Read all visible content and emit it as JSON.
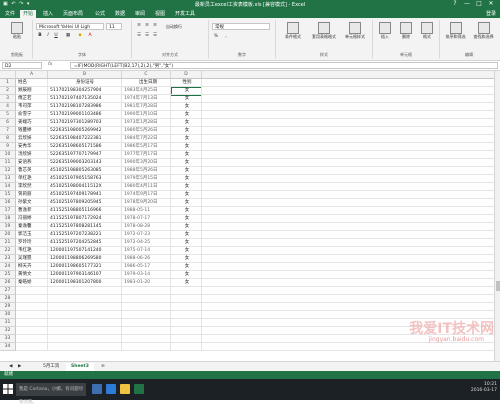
{
  "window": {
    "title": "最新员工excel工资表模板.xls [兼容模式] - Excel",
    "quick_access": "▣ ↶ ↷ ▾",
    "controls": [
      "?",
      "—",
      "□",
      "✕"
    ]
  },
  "ribbon_tabs": [
    "文件",
    "开始",
    "插入",
    "页面布局",
    "公式",
    "数据",
    "审阅",
    "视图",
    "开发工具"
  ],
  "ribbon_active_index": 1,
  "user_label": "登录",
  "ribbon": {
    "clipboard": {
      "paste": "粘贴",
      "caption": "剪贴板"
    },
    "font": {
      "family": "Microsoft YaHei UI Ligh",
      "size": "11",
      "caption": "字体"
    },
    "alignment": {
      "caption": "对齐方式",
      "wrap": "自动换行"
    },
    "number": {
      "format": "常规",
      "caption": "数字"
    },
    "styles": {
      "cond": "条件格式",
      "table": "套用表格格式",
      "cell": "单元格样式",
      "caption": "样式"
    },
    "cells": {
      "insert": "插入",
      "delete": "删除",
      "format": "格式",
      "caption": "单元格"
    },
    "editing": {
      "sort": "排序和筛选",
      "find": "查找和选择",
      "caption": "编辑"
    }
  },
  "formula_bar": {
    "cell_ref": "D2",
    "fx": "fx",
    "formula": "=IF(MOD(RIGHT(LEFT(B2,17),2),2),\"男\",\"女\")"
  },
  "columns": [
    "A",
    "B",
    "C",
    "D"
  ],
  "headers": {
    "name": "姓名",
    "id": "身份证号",
    "birth": "出生日期",
    "sex": "性别"
  },
  "rows": [
    {
      "name": "顾辰刚",
      "id": "511702198304257904",
      "date": "1983年4月25日",
      "sex": "女"
    },
    {
      "name": "傅芷若",
      "id": "511702197407135024",
      "date": "1974年7月13日",
      "sex": "女"
    },
    {
      "name": "韦司萍",
      "id": "511702198107283986",
      "date": "1981年7月28日",
      "sex": "女"
    },
    {
      "name": "俞雪宁",
      "id": "511702199001103486",
      "date": "1990年1月10日",
      "sex": "女"
    },
    {
      "name": "姜端巧",
      "id": "511702197301289703",
      "date": "1973年1月28日",
      "sex": "女"
    },
    {
      "name": "钱蔓婷",
      "id": "522635198005269942",
      "date": "1980年5月26日",
      "sex": "女"
    },
    {
      "name": "云欣妍",
      "id": "522635198407222381",
      "date": "1984年7月22日",
      "sex": "女"
    },
    {
      "name": "安秀华",
      "id": "522635198605171586",
      "date": "1986年5月17日",
      "sex": "女"
    },
    {
      "name": "汤欣妍",
      "id": "522635197707179947",
      "date": "1977年7月17日",
      "sex": "女"
    },
    {
      "name": "安语燕",
      "id": "522635199003203143",
      "date": "1990年3月20日",
      "sex": "女"
    },
    {
      "name": "鲁芯英",
      "id": "451025198805263085",
      "date": "1988年5月26日",
      "sex": "女"
    },
    {
      "name": "单红艳",
      "id": "451025197905158763",
      "date": "1979年5月15日",
      "sex": "女"
    },
    {
      "name": "李欣然",
      "id": "45102519800411512X",
      "date": "1980年4月11日",
      "sex": "女"
    },
    {
      "name": "贺莉丽",
      "id": "451025197409178941",
      "date": "1974年9月17日",
      "sex": "女"
    },
    {
      "name": "孙紫文",
      "id": "451025197809205945",
      "date": "1978年9月20日",
      "sex": "女"
    },
    {
      "name": "曹逸菲",
      "id": "411525198805116966",
      "date": "1988-05-11",
      "sex": "女"
    },
    {
      "name": "冯丽婷",
      "id": "411525197807172924",
      "date": "1978-07-17",
      "sex": "女"
    },
    {
      "name": "秦逸馨",
      "id": "411525197808281145",
      "date": "1978-08-28",
      "sex": "女"
    },
    {
      "name": "郭洁玉",
      "id": "411525197207238221",
      "date": "1972-07-23",
      "sex": "女"
    },
    {
      "name": "罗玲玲",
      "id": "411525197204252845",
      "date": "1972-04-25",
      "sex": "女"
    },
    {
      "name": "韦红艳",
      "id": "120001197507141240",
      "date": "1975-07-14",
      "sex": "女"
    },
    {
      "name": "吴瑾霓",
      "id": "120001198806269580",
      "date": "1988-06-26",
      "sex": "女"
    },
    {
      "name": "柳天卉",
      "id": "120001198605177321",
      "date": "1986-05-17",
      "sex": "女"
    },
    {
      "name": "黄倩文",
      "id": "120001197903146107",
      "date": "1979-03-14",
      "sex": "女"
    },
    {
      "name": "秦皓娇",
      "id": "120001198301207800",
      "date": "1983-01-20",
      "sex": "女"
    }
  ],
  "sheet_tabs": [
    "5月工资",
    "Sheet3"
  ],
  "active_sheet": 1,
  "status": {
    "left": "就绪"
  },
  "taskbar": {
    "search_placeholder": "我是 Cortana，小娜。有问题尽管问我。",
    "time": "10:21",
    "date": "2016-03-17"
  },
  "watermark": {
    "main": "我爱IT技术网",
    "sub": "jingyan.baidu.com"
  },
  "colors": {
    "excel_green": "#217346",
    "taskbar": "#1c2126"
  }
}
